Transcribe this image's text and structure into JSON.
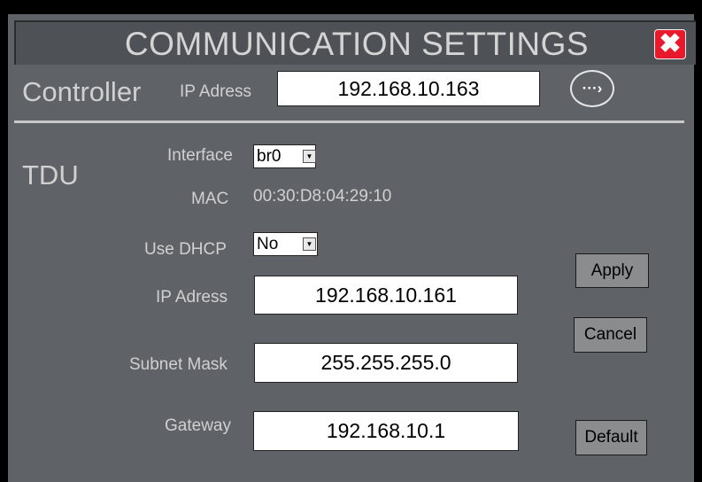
{
  "window": {
    "title": "COMMUNICATION SETTINGS",
    "close_glyph": "✖"
  },
  "controller": {
    "heading": "Controller",
    "ip_label": "IP Adress",
    "ip_value": "192.168.10.163",
    "connect_glyph": "···›"
  },
  "tdu": {
    "heading": "TDU",
    "interface_label": "Interface",
    "interface_value": "br0",
    "mac_label": "MAC",
    "mac_value": "00:30:D8:04:29:10",
    "dhcp_label": "Use DHCP",
    "dhcp_value": "No",
    "ip_label": "IP Adress",
    "ip_value": "192.168.10.161",
    "subnet_label": "Subnet Mask",
    "subnet_value": "255.255.255.0",
    "gateway_label": "Gateway",
    "gateway_value": "192.168.10.1",
    "dropdown_glyph": "▼"
  },
  "buttons": {
    "apply": "Apply",
    "cancel": "Cancel",
    "default": "Default"
  },
  "colors": {
    "panel": "#5f6368",
    "titlebar": "#4e5256",
    "close": "#e8192c",
    "button": "#8a8c8e"
  }
}
